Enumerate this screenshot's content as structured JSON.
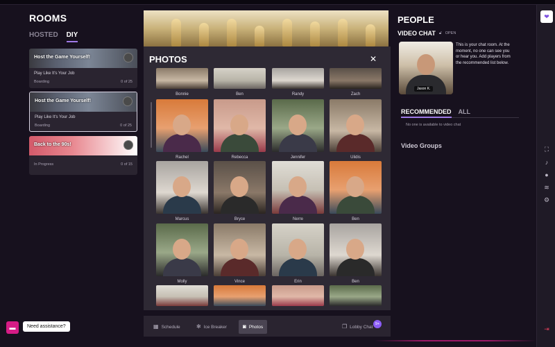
{
  "rooms": {
    "title": "ROOMS",
    "tabs": [
      {
        "label": "HOSTED"
      },
      {
        "label": "DIY"
      }
    ],
    "cards": [
      {
        "banner": "Host the Game Yourself!",
        "subtitle": "Play Like It's Your Job",
        "status": "Boarding",
        "count": "0 of 25"
      },
      {
        "banner": "Host the Game Yourself!",
        "subtitle": "Play Like It's Your Job",
        "status": "Boarding",
        "count": "0 of 25"
      },
      {
        "banner": "Back to the 90s!",
        "subtitle": "",
        "status": "In Progress",
        "count": "0 of 15"
      }
    ]
  },
  "photos": {
    "title": "PHOTOS",
    "close": "✕",
    "names": [
      "Bonnie",
      "Ben",
      "Randy",
      "Zach",
      "Rachel",
      "Rebecca",
      "Jennifer",
      "Ulidis",
      "Marcus",
      "Bryce",
      "Nerre",
      "Ben",
      "Molly",
      "Vince",
      "Erin",
      "Ben"
    ]
  },
  "bottombar": {
    "schedule": "Schedule",
    "icebreaker": "Ice Breaker",
    "photos": "Photos",
    "lobby": "Lobby Chat",
    "lobby_badge": "9+"
  },
  "people": {
    "title": "PEOPLE",
    "video_chat": "VIDEO CHAT",
    "status": "OPEN",
    "user_name": "Jason K.",
    "info": "This is your chat room. At the moment, no one can see you or hear you. Add players from the recommended list below.",
    "tabs": [
      {
        "label": "RECOMMENDED"
      },
      {
        "label": "ALL"
      }
    ],
    "empty": "No one is available to video chat",
    "video_groups": "Video Groups"
  },
  "help": {
    "label": "Need assistance?"
  }
}
